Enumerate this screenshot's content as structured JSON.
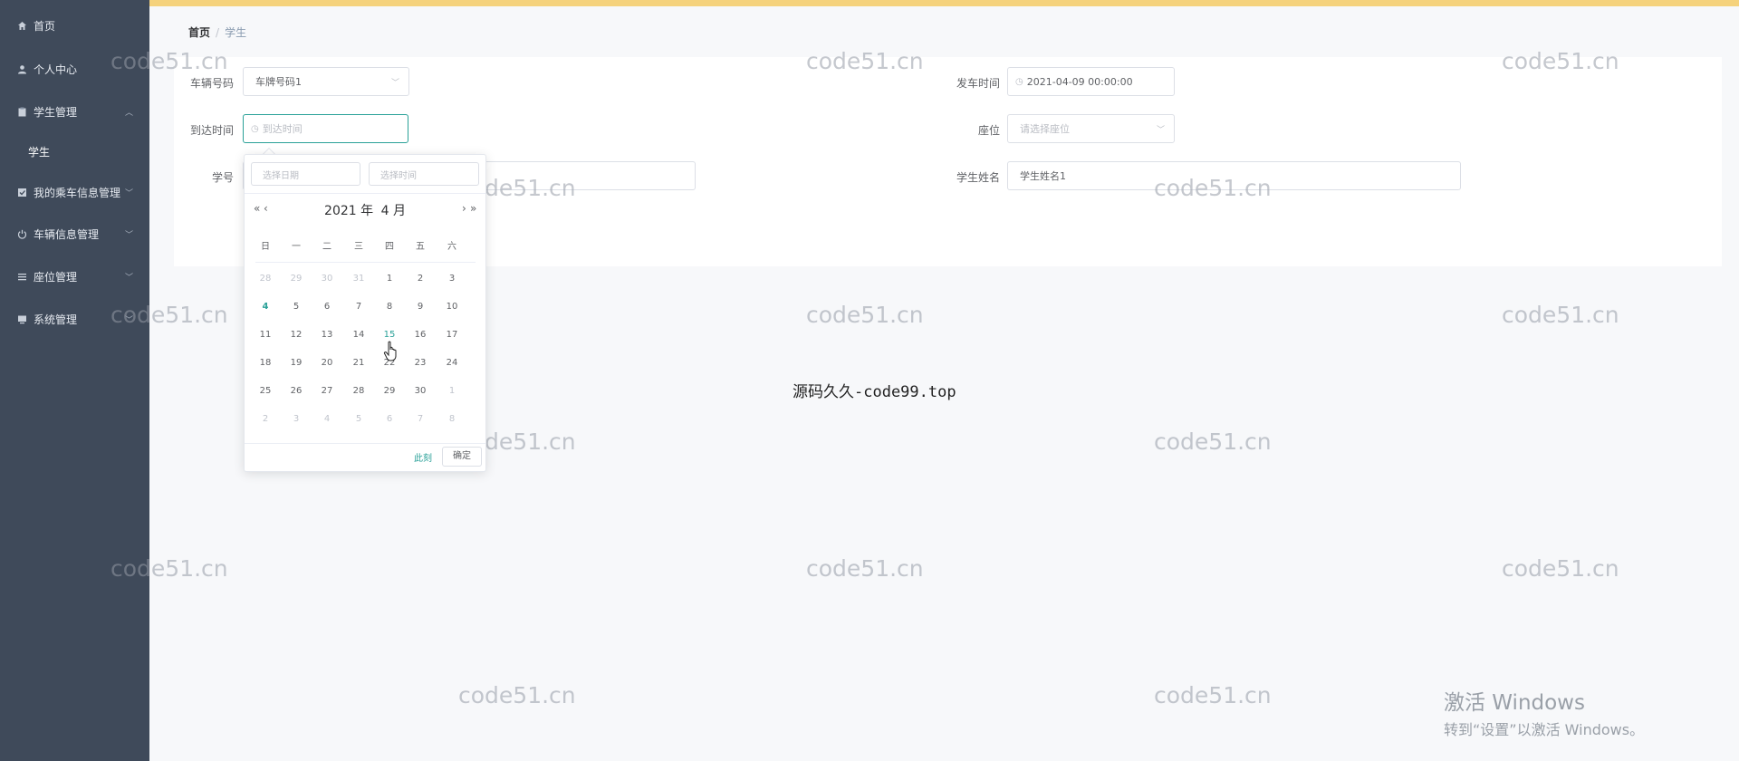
{
  "sidebar": {
    "items": [
      {
        "label": "首页",
        "icon": "home-icon"
      },
      {
        "label": "个人中心",
        "icon": "user-icon"
      },
      {
        "label": "学生管理",
        "icon": "clipboard-icon",
        "expanded": true
      },
      {
        "label": "我的乘车信息管理",
        "icon": "check-square-icon"
      },
      {
        "label": "车辆信息管理",
        "icon": "power-icon"
      },
      {
        "label": "座位管理",
        "icon": "list-icon"
      },
      {
        "label": "系统管理",
        "icon": "monitor-icon"
      }
    ],
    "submenu": [
      {
        "label": "学生"
      }
    ]
  },
  "breadcrumb": {
    "home": "首页",
    "separator": "/",
    "current": "学生"
  },
  "form": {
    "plate": {
      "label": "车辆号码",
      "value": "车牌号码1"
    },
    "depart": {
      "label": "发车时间",
      "value": "2021-04-09 00:00:00"
    },
    "arrive": {
      "label": "到达时间",
      "placeholder": "到达时间"
    },
    "seat": {
      "label": "座位",
      "placeholder": "请选择座位"
    },
    "student_no": {
      "label": "学号"
    },
    "student_name": {
      "label": "学生姓名",
      "value": "学生姓名1"
    }
  },
  "picker": {
    "date_placeholder": "选择日期",
    "time_placeholder": "选择时间",
    "prev_year": "«",
    "prev_month": "‹",
    "next_month": "›",
    "next_year": "»",
    "year": "2021",
    "year_unit": "年",
    "month": "4",
    "month_unit": "月",
    "weekdays": [
      "日",
      "一",
      "二",
      "三",
      "四",
      "五",
      "六"
    ],
    "weeks": [
      [
        {
          "d": "28",
          "o": true
        },
        {
          "d": "29",
          "o": true
        },
        {
          "d": "30",
          "o": true
        },
        {
          "d": "31",
          "o": true
        },
        {
          "d": "1"
        },
        {
          "d": "2"
        },
        {
          "d": "3"
        }
      ],
      [
        {
          "d": "4",
          "t": "today"
        },
        {
          "d": "5"
        },
        {
          "d": "6"
        },
        {
          "d": "7"
        },
        {
          "d": "8"
        },
        {
          "d": "9"
        },
        {
          "d": "10"
        }
      ],
      [
        {
          "d": "11"
        },
        {
          "d": "12"
        },
        {
          "d": "13"
        },
        {
          "d": "14"
        },
        {
          "d": "15",
          "t": "sel"
        },
        {
          "d": "16"
        },
        {
          "d": "17"
        }
      ],
      [
        {
          "d": "18"
        },
        {
          "d": "19"
        },
        {
          "d": "20"
        },
        {
          "d": "21"
        },
        {
          "d": "22"
        },
        {
          "d": "23"
        },
        {
          "d": "24"
        }
      ],
      [
        {
          "d": "25"
        },
        {
          "d": "26"
        },
        {
          "d": "27"
        },
        {
          "d": "28"
        },
        {
          "d": "29"
        },
        {
          "d": "30"
        },
        {
          "d": "1",
          "o": true
        }
      ],
      [
        {
          "d": "2",
          "o": true
        },
        {
          "d": "3",
          "o": true
        },
        {
          "d": "4",
          "o": true
        },
        {
          "d": "5",
          "o": true
        },
        {
          "d": "6",
          "o": true
        },
        {
          "d": "7",
          "o": true
        },
        {
          "d": "8",
          "o": true
        }
      ]
    ],
    "now_label": "此刻",
    "ok_label": "确定"
  },
  "watermark_text": "code51.cn",
  "center_text": "源码久久-code99.top",
  "activation": {
    "title": "激活 Windows",
    "subtitle": "转到“设置”以激活 Windows。"
  },
  "colors": {
    "sidebar": "#3f4a5a",
    "accent": "#2aa198",
    "topbar": "#f5d27c"
  }
}
